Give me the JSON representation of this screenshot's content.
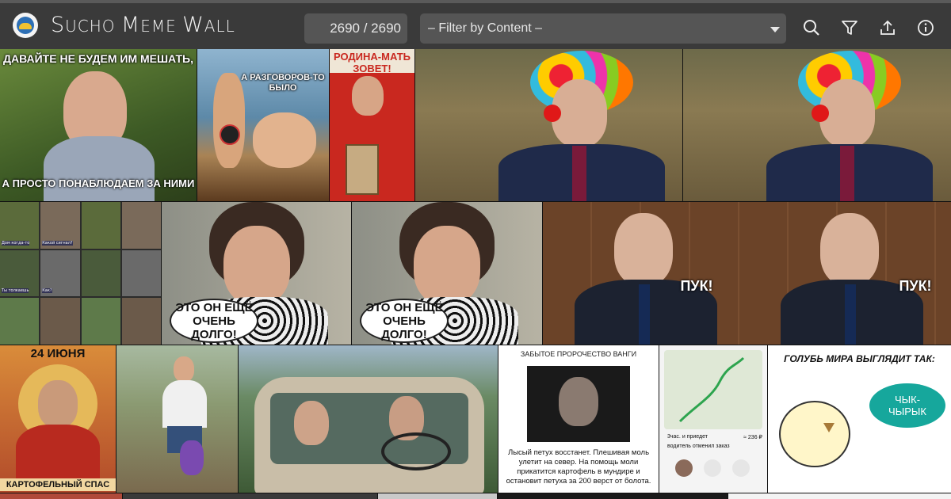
{
  "header": {
    "app_title_s": "S",
    "app_title_ucho": "UCHO ",
    "app_title_m": "M",
    "app_title_eme": "EME ",
    "app_title_w": "W",
    "app_title_all": "ALL",
    "counter_text": "2690 / 2690",
    "filter_placeholder": "– Filter by Content –",
    "icons": [
      "search-icon",
      "filter-icon",
      "upload-icon",
      "info-icon"
    ]
  },
  "memes": {
    "m1": {
      "top": "ДАВАЙТЕ НЕ БУДЕМ ИМ МЕШАТЬ,",
      "bottom": "А ПРОСТО ПОНАБЛЮДАЕМ ЗА НИМИ"
    },
    "m2": {
      "caption": "А РАЗГОВОРОВ-ТО БЫЛО"
    },
    "m3": {
      "caption": "РОДИНА-МАТЬ ЗОВЕТ!"
    },
    "m5": {
      "c1": "Дом когда-то",
      "c2": "Какой сигнал?",
      "c3": "Ты толкаешь",
      "c4": "Как?"
    },
    "m6": {
      "bubble": "ЭТО ОН ЕЩЁ ОЧЕНЬ ДОЛГО!"
    },
    "m7": {
      "bubble": "ЭТО ОН ЕЩЁ ОЧЕНЬ ДОЛГО!"
    },
    "m8": {
      "left": "ПУК!",
      "right": "ПУК!"
    },
    "m9": {
      "top": "24 ИЮНЯ",
      "bottom": "КАРТОФЕЛЬНЫЙ СПАС"
    },
    "m12": {
      "title": "ЗАБЫТОЕ ПРОРОЧЕСТВО ВАНГИ",
      "body": "Лысый петух восстанет. Плешивая моль улетит на север. На помощь моли прикатится картофель в мундире и остановит петуха за 200 верст от болота."
    },
    "m13": {
      "eta": "3час. и приедет",
      "price": "≈ 236 ₽",
      "status": "водитель отменил заказ"
    },
    "m14": {
      "title": "ГОЛУБЬ МИРА ВЫГЛЯДИТ ТАК:",
      "bubble": "ЧЫК-ЧЫРЫК"
    }
  },
  "colors": {
    "topbar": "#3a3a3a",
    "control": "#555555",
    "text": "#f2f2f2"
  }
}
